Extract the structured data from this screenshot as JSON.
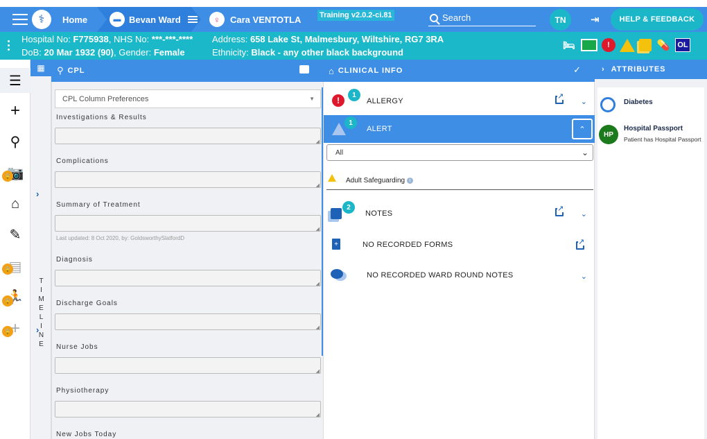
{
  "topnav": {
    "home_label": "Home",
    "ward_label": "Bevan Ward",
    "patient_label": "Cara VENTOTLA",
    "training_label": "Training v2.0.2-ci.81",
    "search_placeholder": "Search",
    "user_initials": "TN",
    "help_label": "HELP & FEEDBACK"
  },
  "banner": {
    "hospital_no_label": "Hospital No:",
    "hospital_no": "F775938",
    "nhs_no_label": ", NHS No:",
    "nhs_no": "***-***-****",
    "dob_label": "DoB:",
    "dob": "20 Mar 1932 (90)",
    "gender_label": ", Gender:",
    "gender": "Female",
    "address_label": "Address:",
    "address": "658 Lake St, Malmesbury, Wiltshire, RG7 3RA",
    "ethnicity_label": "Ethnicity:",
    "ethnicity": "Black - any other black background",
    "icons": [
      "bed-icon",
      "green-status-icon",
      "red-alert-icon",
      "warning-icon",
      "notes-icon",
      "medication-icon"
    ],
    "ol_badge": "OL"
  },
  "sidebar": {
    "icons": [
      "list-icon",
      "plus-icon",
      "stethoscope-icon",
      "camera-icon",
      "home-icon",
      "chart-document-icon",
      "clipboard-icon",
      "running-person-icon",
      "cross-icon"
    ]
  },
  "timeline": {
    "label": "TIMELINE"
  },
  "cpl": {
    "title": "CPL",
    "column_prefs_placeholder": "CPL Column Preferences",
    "sections": [
      {
        "label": "Investigations & Results"
      },
      {
        "label": "Complications"
      },
      {
        "label": "Summary of Treatment",
        "meta": "Last updated: 8 Oct 2020, by: GoldsworthySlatfordD"
      },
      {
        "label": "Diagnosis"
      },
      {
        "label": "Discharge Goals"
      },
      {
        "label": "Nurse Jobs"
      },
      {
        "label": "Physiotherapy"
      },
      {
        "label": "New Jobs Today"
      }
    ]
  },
  "clinical": {
    "title": "CLINICAL INFO",
    "allergy": {
      "label": "ALLERGY",
      "count": "1"
    },
    "alert": {
      "label": "ALERT",
      "count": "1"
    },
    "filter_value": "All",
    "alert_item": "Adult Safeguarding",
    "notes": {
      "label": "NOTES",
      "count": "2"
    },
    "forms_label": "NO RECORDED FORMS",
    "ward_round_label": "NO RECORDED WARD ROUND NOTES"
  },
  "attributes": {
    "title": "ATTRIBUTES",
    "items": [
      {
        "name": "Diabetes"
      },
      {
        "name": "Hospital Passport",
        "badge": "HP",
        "desc": "Patient has Hospital Passport"
      }
    ]
  }
}
